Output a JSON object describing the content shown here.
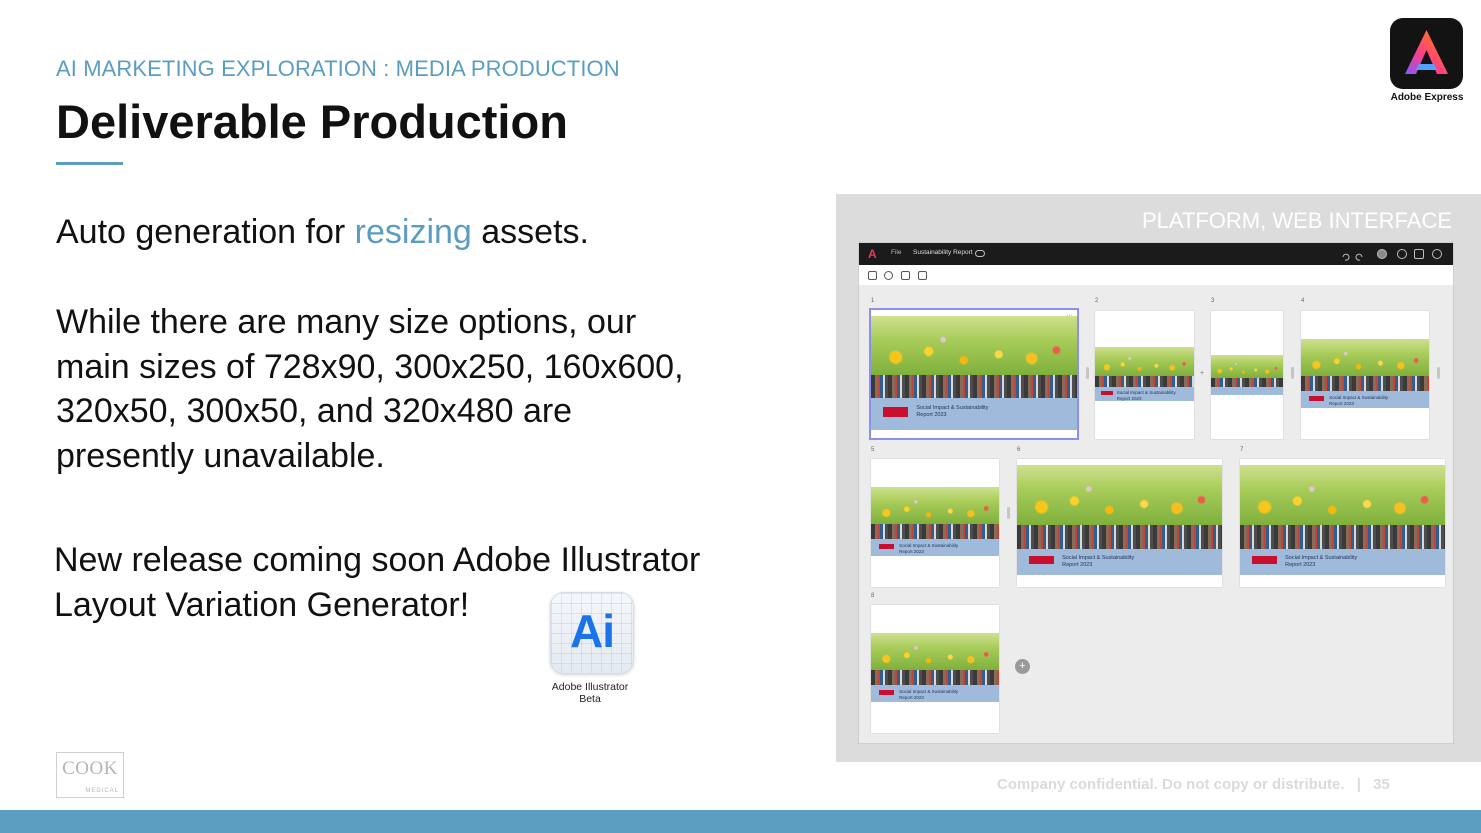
{
  "kicker": "AI MARKETING EXPLORATION : MEDIA PRODUCTION",
  "title": "Deliverable Production",
  "intro": {
    "before": "Auto generation for ",
    "highlight": "resizing",
    "after": " assets."
  },
  "sizes_paragraph": [
    "While there are many size options, our",
    "main sizes of 728x90, 300x250, 160x600,",
    "320x50, 300x50, and 320x480 are",
    "presently unavailable."
  ],
  "release_paragraph": [
    "New release coming soon Adobe Illustrator",
    "Layout Variation Generator!"
  ],
  "illustrator_icon": {
    "glyph": "Ai",
    "label_line1": "Adobe Illustrator",
    "label_line2": "Beta"
  },
  "adobe_express": {
    "label": "Adobe Express",
    "icon": "adobe-express-a-icon"
  },
  "cook_logo": {
    "name": "COOK",
    "sub": "MEDICAL"
  },
  "panel": {
    "title": "PLATFORM, WEB INTERFACE",
    "app": {
      "menu_file": "File",
      "document_title": "Sustainability Report",
      "pages": [
        {
          "number": "1",
          "banner": [
            "Social Impact & Sustainability",
            "Report 2023"
          ]
        },
        {
          "number": "2",
          "banner": [
            "Social Impact & Sustainability",
            "Report 2023"
          ]
        },
        {
          "number": "3",
          "banner": [
            "",
            ""
          ]
        },
        {
          "number": "4",
          "banner": [
            "Social Impact & Sustainability",
            "Report 2023"
          ]
        },
        {
          "number": "5",
          "banner": [
            "Social Impact & Sustainability",
            "Report 2023"
          ]
        },
        {
          "number": "6",
          "banner": [
            "Social Impact & Sustainability",
            "Report 2023"
          ]
        },
        {
          "number": "7",
          "banner": [
            "Social Impact & Sustainability",
            "Report 2023"
          ]
        },
        {
          "number": "8",
          "banner": [
            "Social Impact & Sustainability",
            "Report 2023"
          ]
        }
      ],
      "add_page": "+"
    }
  },
  "footer": {
    "confidential": "Company confidential. Do not copy or distribute.",
    "separator": "|",
    "page_number": "35"
  },
  "colors": {
    "accent": "#5b9dc0",
    "bar": "#5b9dc0"
  }
}
